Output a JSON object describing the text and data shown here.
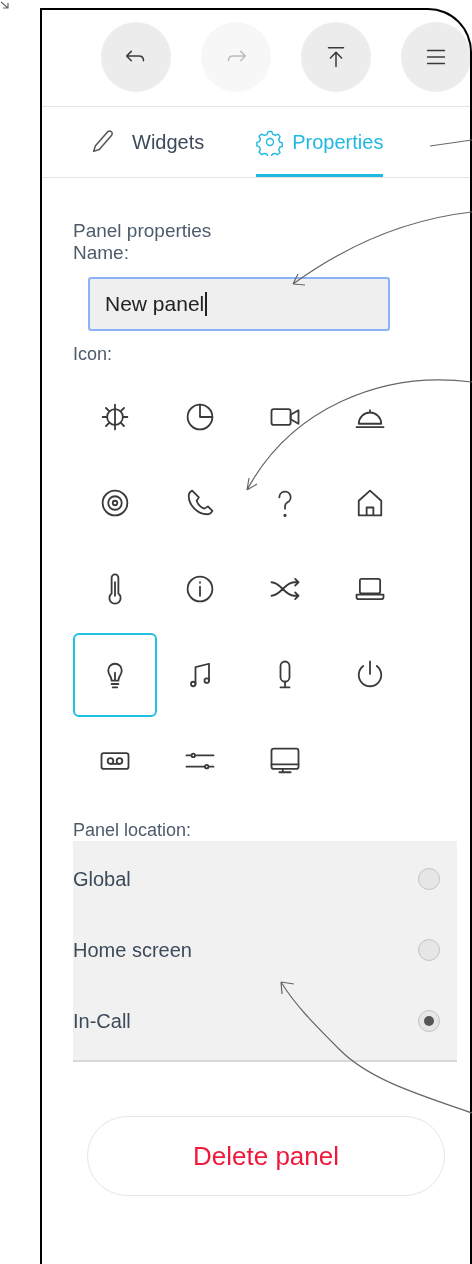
{
  "toolbar": [
    {
      "kind": "undo",
      "disabled": false
    },
    {
      "kind": "redo",
      "disabled": true
    },
    {
      "kind": "upload",
      "disabled": false
    },
    {
      "kind": "menu",
      "disabled": false
    }
  ],
  "tabs": [
    {
      "label": "Widgets",
      "kind": "pencil",
      "selected": false
    },
    {
      "label": "Properties",
      "kind": "gear",
      "selected": true
    }
  ],
  "panel_properties": {
    "heading": "Panel properties",
    "name_label": "Name:",
    "name_value": "New panel",
    "icon_label": "Icon:",
    "icons": [
      {
        "kind": "sun",
        "selected": false
      },
      {
        "kind": "pie",
        "selected": false
      },
      {
        "kind": "camera",
        "selected": false
      },
      {
        "kind": "bell",
        "selected": false
      },
      {
        "kind": "target",
        "selected": false
      },
      {
        "kind": "phone",
        "selected": false
      },
      {
        "kind": "help",
        "selected": false
      },
      {
        "kind": "home",
        "selected": false
      },
      {
        "kind": "thermometer",
        "selected": false
      },
      {
        "kind": "info",
        "selected": false
      },
      {
        "kind": "shuffle",
        "selected": false
      },
      {
        "kind": "laptop",
        "selected": false
      },
      {
        "kind": "bulb",
        "selected": true
      },
      {
        "kind": "music",
        "selected": false
      },
      {
        "kind": "mic",
        "selected": false
      },
      {
        "kind": "power",
        "selected": false
      },
      {
        "kind": "voicemail",
        "selected": false
      },
      {
        "kind": "sliders",
        "selected": false
      },
      {
        "kind": "monitor",
        "selected": false
      }
    ],
    "location_label": "Panel location:",
    "locations": [
      {
        "label": "Global",
        "selected": false
      },
      {
        "label": "Home screen",
        "selected": false
      },
      {
        "label": "In-Call",
        "selected": true
      }
    ]
  },
  "delete_button": "Delete panel"
}
